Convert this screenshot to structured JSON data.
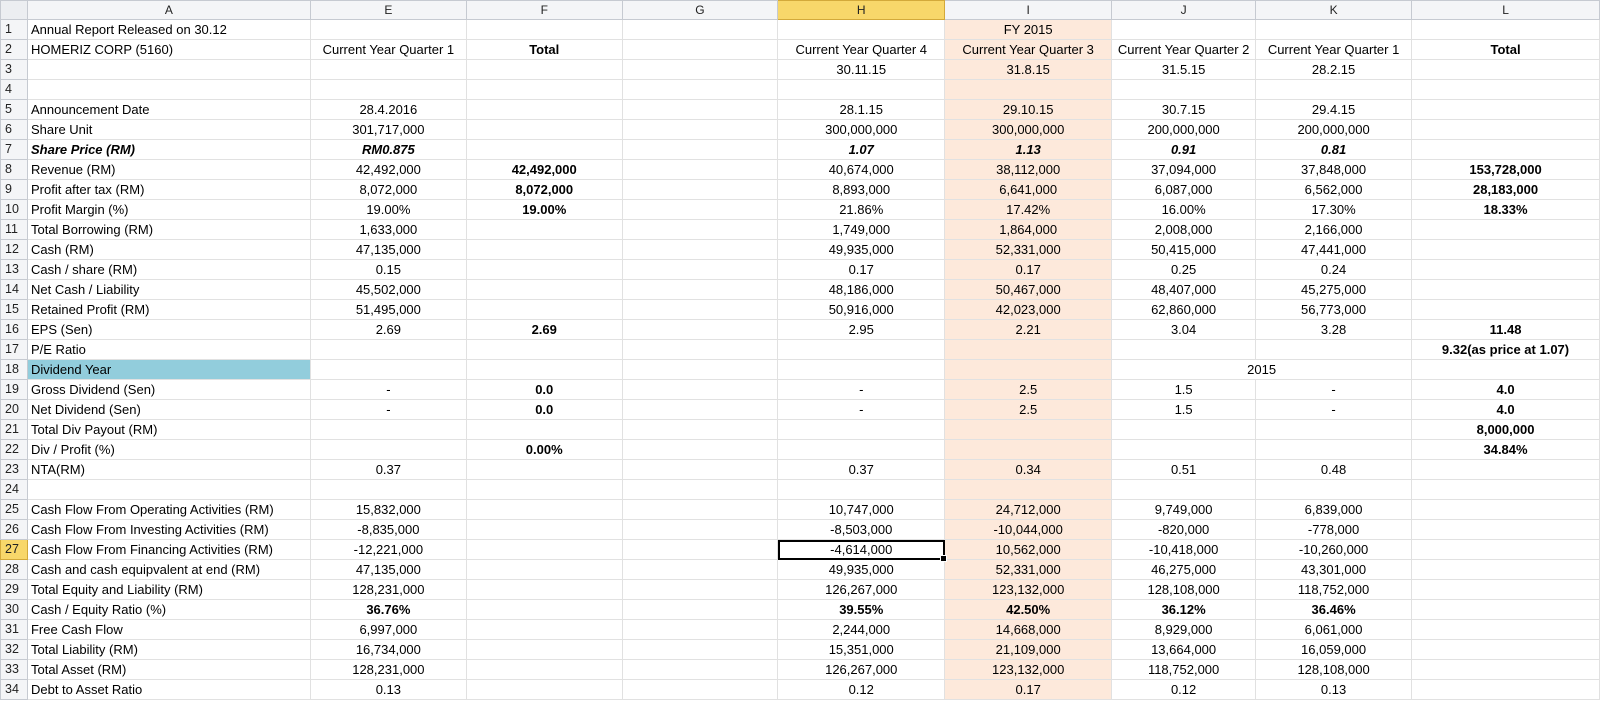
{
  "columns": [
    "A",
    "E",
    "F",
    "G",
    "H",
    "I",
    "J",
    "K",
    "L"
  ],
  "selected_column": "H",
  "selected_row": 27,
  "colors": {
    "shade": "#fde9db",
    "highlight_blue": "#92cddc",
    "selection_header": "#f8d76a"
  },
  "rows": [
    {
      "n": "1",
      "A": "Annual Report Released on 30.12",
      "E": "",
      "F": "",
      "G": "",
      "H": "",
      "I": "FY 2015",
      "J": "",
      "K": "",
      "L": ""
    },
    {
      "n": "2",
      "A": "HOMERIZ CORP (5160)",
      "E": "Current Year Quarter 1",
      "F": "Total",
      "G": "",
      "H": "Current Year Quarter 4",
      "I": "Current Year Quarter 3",
      "J": "Current Year Quarter 2",
      "K": "Current Year Quarter 1",
      "L": "Total"
    },
    {
      "n": "3",
      "A": "",
      "E": "",
      "F": "",
      "G": "",
      "H": "30.11.15",
      "I": "31.8.15",
      "J": "31.5.15",
      "K": "28.2.15",
      "L": ""
    },
    {
      "n": "4",
      "A": "",
      "E": "",
      "F": "",
      "G": "",
      "H": "",
      "I": "",
      "J": "",
      "K": "",
      "L": ""
    },
    {
      "n": "5",
      "A": "Announcement Date",
      "E": "28.4.2016",
      "F": "",
      "G": "",
      "H": "28.1.15",
      "I": "29.10.15",
      "J": "30.7.15",
      "K": "29.4.15",
      "L": ""
    },
    {
      "n": "6",
      "A": "Share Unit",
      "E": "301,717,000",
      "F": "",
      "G": "",
      "H": "300,000,000",
      "I": "300,000,000",
      "J": "200,000,000",
      "K": "200,000,000",
      "L": ""
    },
    {
      "n": "7",
      "A": "Share Price (RM)",
      "E": "RM0.875",
      "F": "",
      "G": "",
      "H": "1.07",
      "I": "1.13",
      "J": "0.91",
      "K": "0.81",
      "L": ""
    },
    {
      "n": "8",
      "A": "Revenue (RM)",
      "E": "42,492,000",
      "F": "42,492,000",
      "G": "",
      "H": "40,674,000",
      "I": "38,112,000",
      "J": "37,094,000",
      "K": "37,848,000",
      "L": "153,728,000"
    },
    {
      "n": "9",
      "A": "Profit after tax (RM)",
      "E": "8,072,000",
      "F": "8,072,000",
      "G": "",
      "H": "8,893,000",
      "I": "6,641,000",
      "J": "6,087,000",
      "K": "6,562,000",
      "L": "28,183,000"
    },
    {
      "n": "10",
      "A": "Profit Margin (%)",
      "E": "19.00%",
      "F": "19.00%",
      "G": "",
      "H": "21.86%",
      "I": "17.42%",
      "J": "16.00%",
      "K": "17.30%",
      "L": "18.33%"
    },
    {
      "n": "11",
      "A": "Total Borrowing (RM)",
      "E": "1,633,000",
      "F": "",
      "G": "",
      "H": "1,749,000",
      "I": "1,864,000",
      "J": "2,008,000",
      "K": "2,166,000",
      "L": ""
    },
    {
      "n": "12",
      "A": "Cash (RM)",
      "E": "47,135,000",
      "F": "",
      "G": "",
      "H": "49,935,000",
      "I": "52,331,000",
      "J": "50,415,000",
      "K": "47,441,000",
      "L": ""
    },
    {
      "n": "13",
      "A": "Cash / share (RM)",
      "E": "0.15",
      "F": "",
      "G": "",
      "H": "0.17",
      "I": "0.17",
      "J": "0.25",
      "K": "0.24",
      "L": ""
    },
    {
      "n": "14",
      "A": "Net Cash / Liability",
      "E": "45,502,000",
      "F": "",
      "G": "",
      "H": "48,186,000",
      "I": "50,467,000",
      "J": "48,407,000",
      "K": "45,275,000",
      "L": ""
    },
    {
      "n": "15",
      "A": "Retained Profit (RM)",
      "E": "51,495,000",
      "F": "",
      "G": "",
      "H": "50,916,000",
      "I": "42,023,000",
      "J": "62,860,000",
      "K": "56,773,000",
      "L": ""
    },
    {
      "n": "16",
      "A": "EPS (Sen)",
      "E": "2.69",
      "F": "2.69",
      "G": "",
      "H": "2.95",
      "I": "2.21",
      "J": "3.04",
      "K": "3.28",
      "L": "11.48"
    },
    {
      "n": "17",
      "A": "P/E Ratio",
      "E": "",
      "F": "",
      "G": "",
      "H": "",
      "I": "",
      "J": "",
      "K": "",
      "L": "9.32(as price at 1.07)"
    },
    {
      "n": "18",
      "A": "Dividend Year",
      "E": "",
      "F": "",
      "G": "",
      "H": "",
      "I": "",
      "J": "",
      "K": "",
      "L": ""
    },
    {
      "n": "19",
      "A": "Gross Dividend (Sen)",
      "E": "-",
      "F": "0.0",
      "G": "",
      "H": "-",
      "I": "2.5",
      "J": "1.5",
      "K": "-",
      "L": "4.0"
    },
    {
      "n": "20",
      "A": "Net Dividend (Sen)",
      "E": "-",
      "F": "0.0",
      "G": "",
      "H": "-",
      "I": "2.5",
      "J": "1.5",
      "K": "-",
      "L": "4.0"
    },
    {
      "n": "21",
      "A": "Total Div Payout (RM)",
      "E": "",
      "F": "",
      "G": "",
      "H": "",
      "I": "",
      "J": "",
      "K": "",
      "L": "8,000,000"
    },
    {
      "n": "22",
      "A": "Div / Profit (%)",
      "E": "",
      "F": "0.00%",
      "G": "",
      "H": "",
      "I": "",
      "J": "",
      "K": "",
      "L": "34.84%"
    },
    {
      "n": "23",
      "A": "NTA(RM)",
      "E": "0.37",
      "F": "",
      "G": "",
      "H": "0.37",
      "I": "0.34",
      "J": "0.51",
      "K": "0.48",
      "L": ""
    },
    {
      "n": "24",
      "A": "",
      "E": "",
      "F": "",
      "G": "",
      "H": "",
      "I": "",
      "J": "",
      "K": "",
      "L": ""
    },
    {
      "n": "25",
      "A": "Cash Flow From Operating Activities (RM)",
      "E": "15,832,000",
      "F": "",
      "G": "",
      "H": "10,747,000",
      "I": "24,712,000",
      "J": "9,749,000",
      "K": "6,839,000",
      "L": ""
    },
    {
      "n": "26",
      "A": "Cash Flow From Investing Activities (RM)",
      "E": "-8,835,000",
      "F": "",
      "G": "",
      "H": "-8,503,000",
      "I": "-10,044,000",
      "J": "-820,000",
      "K": "-778,000",
      "L": ""
    },
    {
      "n": "27",
      "A": "Cash Flow From Financing Activities (RM)",
      "E": "-12,221,000",
      "F": "",
      "G": "",
      "H": "-4,614,000",
      "I": "10,562,000",
      "J": "-10,418,000",
      "K": "-10,260,000",
      "L": ""
    },
    {
      "n": "28",
      "A": "Cash and cash equipvalent at end (RM)",
      "E": "47,135,000",
      "F": "",
      "G": "",
      "H": "49,935,000",
      "I": "52,331,000",
      "J": "46,275,000",
      "K": "43,301,000",
      "L": ""
    },
    {
      "n": "29",
      "A": "Total Equity and Liability (RM)",
      "E": "128,231,000",
      "F": "",
      "G": "",
      "H": "126,267,000",
      "I": "123,132,000",
      "J": "128,108,000",
      "K": "118,752,000",
      "L": ""
    },
    {
      "n": "30",
      "A": "Cash / Equity Ratio (%)",
      "E": "36.76%",
      "F": "",
      "G": "",
      "H": "39.55%",
      "I": "42.50%",
      "J": "36.12%",
      "K": "36.46%",
      "L": ""
    },
    {
      "n": "31",
      "A": "Free Cash Flow",
      "E": "6,997,000",
      "F": "",
      "G": "",
      "H": "2,244,000",
      "I": "14,668,000",
      "J": "8,929,000",
      "K": "6,061,000",
      "L": ""
    },
    {
      "n": "32",
      "A": "Total Liability (RM)",
      "E": "16,734,000",
      "F": "",
      "G": "",
      "H": "15,351,000",
      "I": "21,109,000",
      "J": "13,664,000",
      "K": "16,059,000",
      "L": ""
    },
    {
      "n": "33",
      "A": "Total Asset (RM)",
      "E": "128,231,000",
      "F": "",
      "G": "",
      "H": "126,267,000",
      "I": "123,132,000",
      "J": "118,752,000",
      "K": "128,108,000",
      "L": ""
    },
    {
      "n": "34",
      "A": "Debt to Asset Ratio",
      "E": "0.13",
      "F": "",
      "G": "",
      "H": "0.12",
      "I": "0.17",
      "J": "0.12",
      "K": "0.13",
      "L": ""
    }
  ],
  "dividend_year_label": "2015"
}
